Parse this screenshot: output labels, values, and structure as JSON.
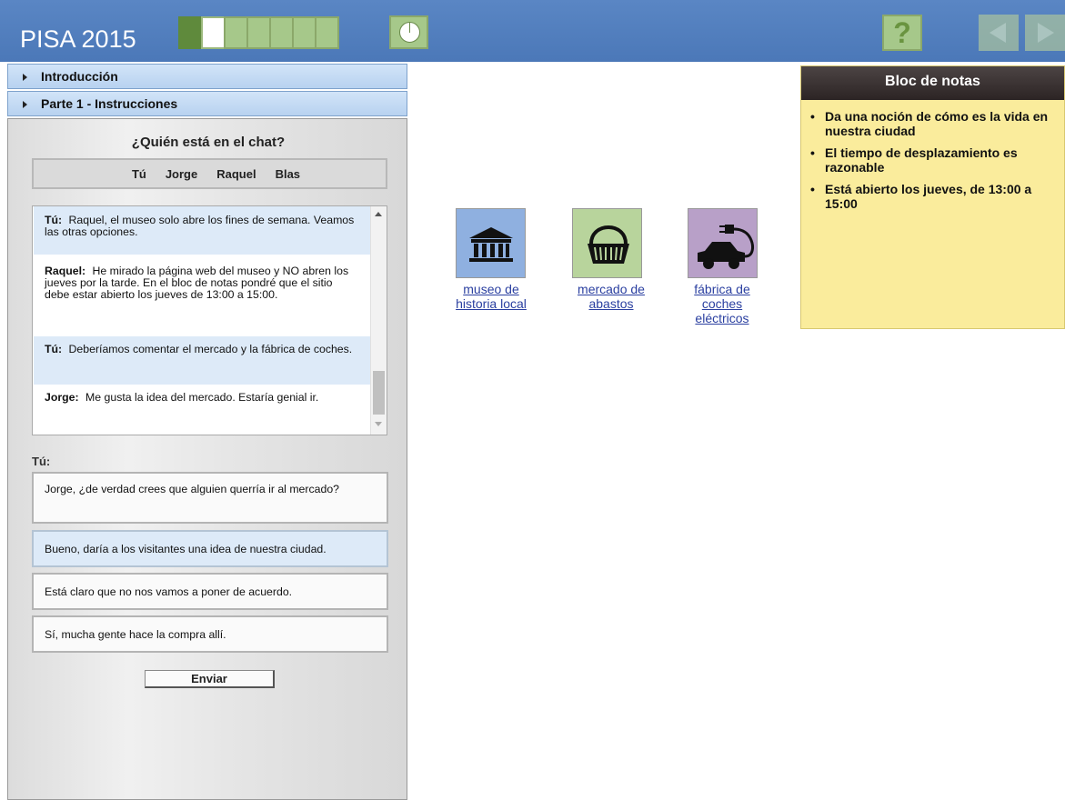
{
  "app": {
    "title": "PISA 2015"
  },
  "progress": {
    "total_units": 7,
    "completed_units": 1,
    "current_unit": 2
  },
  "toolbar": {
    "help_label": "?",
    "help_icon": "question-icon",
    "timer_icon": "clock-icon",
    "prev_icon": "arrow-left-icon",
    "next_icon": "arrow-right-icon"
  },
  "sections": [
    {
      "label": "Introducción"
    },
    {
      "label": "Parte 1 - Instrucciones"
    }
  ],
  "chat": {
    "question": "¿Quién está en el chat?",
    "participants": [
      "Tú",
      "Jorge",
      "Raquel",
      "Blas"
    ],
    "messages": [
      {
        "speaker": "Tú:",
        "text": "Raquel, el museo solo abre los fines de semana. Veamos las otras opciones."
      },
      {
        "speaker": "Raquel:",
        "text": "He mirado la página web del museo y NO abren los jueves por la tarde. En el bloc de notas pondré que el sitio debe estar abierto los jueves de 13:00 a 15:00."
      },
      {
        "speaker": "Tú:",
        "text": "Deberíamos comentar el mercado y la fábrica de coches."
      },
      {
        "speaker": "Jorge:",
        "text": "Me gusta la idea del mercado. Estaría genial ir."
      }
    ],
    "you_label": "Tú:",
    "options": [
      "Jorge, ¿de verdad crees que alguien querría ir al mercado?",
      "Bueno, daría a los visitantes una idea de nuestra ciudad.",
      "Está claro que no nos vamos a poner de acuerdo.",
      "Sí, mucha gente hace la compra allí."
    ],
    "selected_option": 1,
    "send_label": "Enviar"
  },
  "places": [
    {
      "label": "museo de historia local",
      "icon": "museum-icon",
      "color": "#8fb0e0"
    },
    {
      "label": "mercado de abastos",
      "icon": "basket-icon",
      "color": "#b8d49c"
    },
    {
      "label": "fábrica de coches eléctricos",
      "icon": "electric-car-icon",
      "color": "#b8a0c8"
    }
  ],
  "notepad": {
    "title": "Bloc de notas",
    "items": [
      "Da una noción de cómo es la vida en nuestra ciudad",
      "El tiempo de desplazamiento es razonable",
      "Está abierto los jueves, de 13:00 a 15:00"
    ]
  },
  "colors": {
    "topbar": "#4b78b8",
    "progress_done": "#5f8a3c",
    "progress_pending": "#a6c88a",
    "link": "#2a3fa0",
    "notepad_bg": "#faec9c",
    "selected_bg": "#ddeaf8"
  }
}
